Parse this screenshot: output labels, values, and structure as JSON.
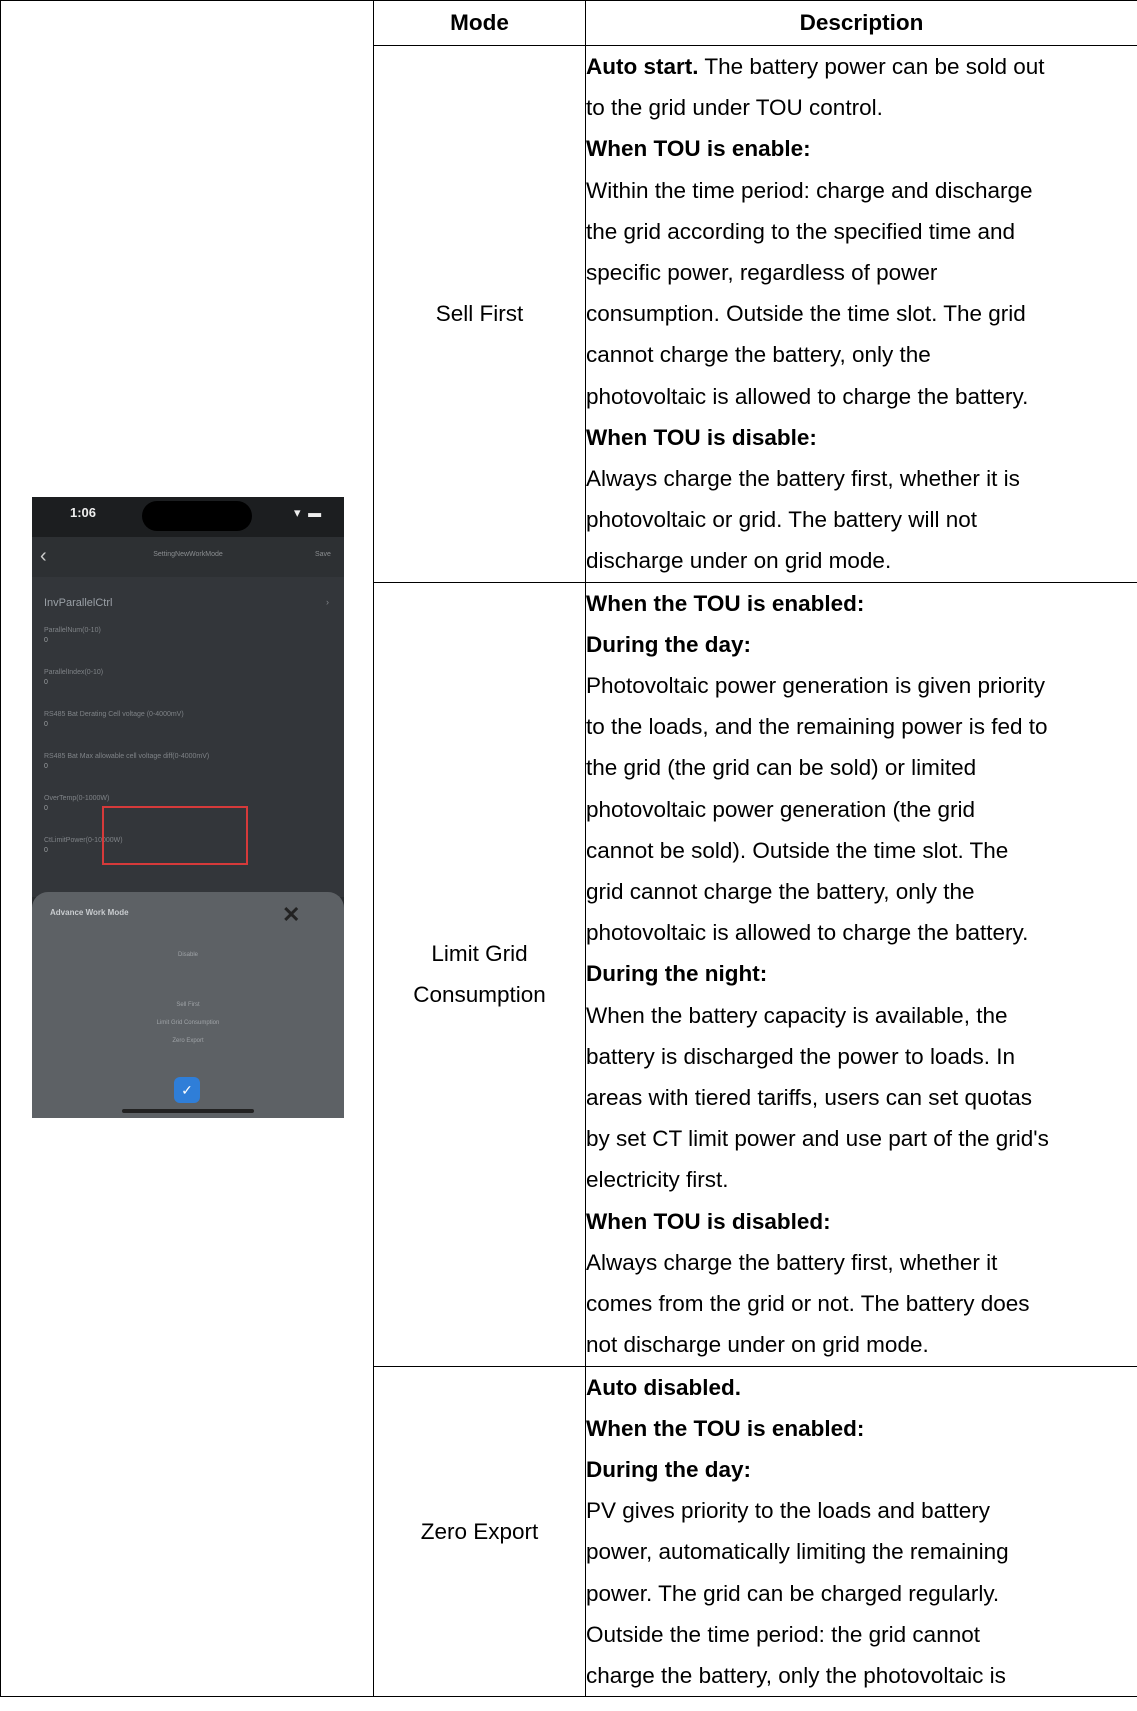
{
  "table": {
    "headers": [
      "Mode",
      "Description"
    ],
    "rows": [
      {
        "mode": "Sell First",
        "lines": [
          {
            "b": "Auto start.",
            "t": " The battery power can be sold out"
          },
          {
            "t": "to the grid under TOU control."
          },
          {
            "b": "When TOU is enable:"
          },
          {
            "t": "Within the time period: charge and discharge"
          },
          {
            "t": "the grid according to the specified time and"
          },
          {
            "t": "specific power, regardless of power"
          },
          {
            "t": "consumption. Outside the time slot. The grid"
          },
          {
            "t": "cannot charge the battery, only the"
          },
          {
            "t": "photovoltaic is allowed to charge the battery."
          },
          {
            "b": "When TOU is disable:"
          },
          {
            "t": "Always charge the battery first, whether it is"
          },
          {
            "t": "photovoltaic or grid. The battery will not"
          },
          {
            "t": "discharge under on grid mode."
          }
        ]
      },
      {
        "mode": "Limit Grid Consumption",
        "lines": [
          {
            "b": "When the TOU is enabled:"
          },
          {
            "b": "During the day:"
          },
          {
            "t": "Photovoltaic power generation is given priority"
          },
          {
            "t": "to the loads, and the remaining power is fed to"
          },
          {
            "t": "the grid (the grid can be sold) or limited"
          },
          {
            "t": "photovoltaic power generation (the grid"
          },
          {
            "t": "cannot be sold). Outside the time slot. The"
          },
          {
            "t": "grid cannot charge the battery, only the"
          },
          {
            "t": "photovoltaic is allowed to charge the battery."
          },
          {
            "b": "During the night:"
          },
          {
            "t": "When the battery capacity is available, the"
          },
          {
            "t": "battery is discharged the power to loads. In"
          },
          {
            "t": "areas with tiered tariffs, users can set quotas"
          },
          {
            "t": "by set CT limit power and use part of the grid's"
          },
          {
            "t": "electricity first."
          },
          {
            "b": "When TOU is disabled:"
          },
          {
            "t": "Always charge the battery first, whether it"
          },
          {
            "t": "comes from the grid or not. The battery does"
          },
          {
            "t": "not discharge under on grid mode."
          }
        ]
      },
      {
        "mode": "Zero Export",
        "lines": [
          {
            "b": "Auto disabled."
          },
          {
            "b": "When the TOU is enabled:"
          },
          {
            "b": "During the day:"
          },
          {
            "t": "PV gives priority to the loads and battery"
          },
          {
            "t": "power, automatically limiting the remaining"
          },
          {
            "t": "power. The grid can be charged regularly."
          },
          {
            "t": "Outside the time period: the grid cannot"
          },
          {
            "t": "charge the battery, only the photovoltaic is"
          }
        ]
      }
    ]
  },
  "phone": {
    "time": "1:06",
    "status_icons": "▾ ▬",
    "back_icon": "‹",
    "nav_title": "SettingNewWorkMode",
    "nav_save": "Save",
    "section_title": "InvParallelCtrl",
    "section_arrow": "›",
    "settings": [
      {
        "label": "ParallelNum(0-10)",
        "value": "0"
      },
      {
        "label": "ParallelIndex(0-10)",
        "value": "0"
      },
      {
        "label": "RS485 Bat Derating Cell voltage (0-4000mV)",
        "value": "0"
      },
      {
        "label": "RS485 Bat Max allowable cell voltage diff(0-4000mV)",
        "value": "0"
      },
      {
        "label": "OverTemp(0-1000W)",
        "value": "0"
      },
      {
        "label": "CtLimitPower(0-10000W)",
        "value": "0"
      }
    ],
    "sheet_title": "Advance Work Mode",
    "sheet_close": "✕",
    "options": [
      "Disable",
      "Sell First",
      "Limit Grid Consumption",
      "Zero Export"
    ],
    "confirm_icon": "✓"
  }
}
